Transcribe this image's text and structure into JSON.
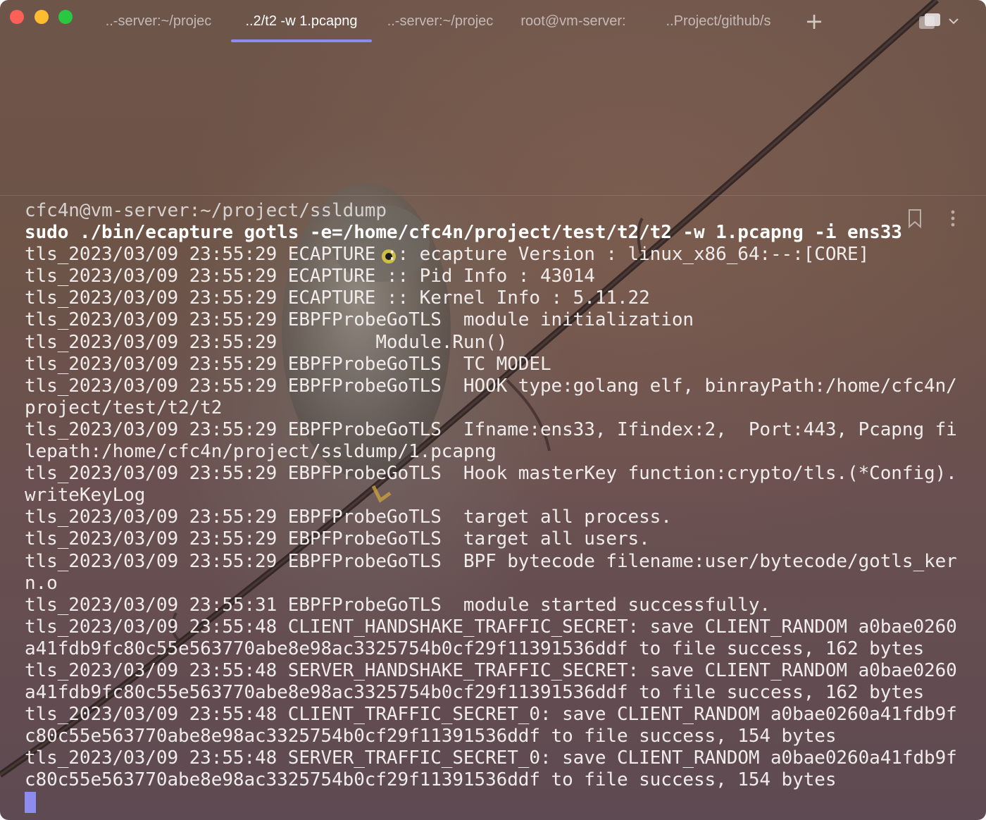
{
  "tabs": [
    {
      "label": "..-server:~/projec",
      "active": false
    },
    {
      "label": "..2/t2 -w 1.pcapng",
      "active": true
    },
    {
      "label": "..-server:~/projec",
      "active": false
    },
    {
      "label": "root@vm-server:",
      "active": false
    },
    {
      "label": "..Project/github/s",
      "active": false
    }
  ],
  "toolbar": {
    "new_tab_label": "+",
    "icons": [
      "split-view-icon",
      "chevron-down-icon",
      "bookmark-icon",
      "more-vertical-icon"
    ]
  },
  "colors": {
    "accent": "#8c8cf0",
    "text": "#f0ecec",
    "traffic_red": "#fe5f57",
    "traffic_yellow": "#febc2e",
    "traffic_green": "#28c840"
  },
  "terminal": {
    "prompt": "cfc4n@vm-server:~/project/ssldump",
    "command": "sudo ./bin/ecapture gotls -e=/home/cfc4n/project/test/t2/t2 -w 1.pcapng -i ens33",
    "lines": [
      "tls_2023/03/09 23:55:29 ECAPTURE :: ecapture Version : linux_x86_64:--:[CORE]",
      "tls_2023/03/09 23:55:29 ECAPTURE :: Pid Info : 43014",
      "tls_2023/03/09 23:55:29 ECAPTURE :: Kernel Info : 5.11.22",
      "tls_2023/03/09 23:55:29 EBPFProbeGoTLS  module initialization",
      "tls_2023/03/09 23:55:29         Module.Run()",
      "tls_2023/03/09 23:55:29 EBPFProbeGoTLS  TC MODEL",
      "tls_2023/03/09 23:55:29 EBPFProbeGoTLS  HOOK type:golang elf, binrayPath:/home/cfc4n/",
      "project/test/t2/t2",
      "tls_2023/03/09 23:55:29 EBPFProbeGoTLS  Ifname:ens33, Ifindex:2,  Port:443, Pcapng fi",
      "lepath:/home/cfc4n/project/ssldump/1.pcapng",
      "tls_2023/03/09 23:55:29 EBPFProbeGoTLS  Hook masterKey function:crypto/tls.(*Config).",
      "writeKeyLog",
      "tls_2023/03/09 23:55:29 EBPFProbeGoTLS  target all process.",
      "tls_2023/03/09 23:55:29 EBPFProbeGoTLS  target all users.",
      "tls_2023/03/09 23:55:29 EBPFProbeGoTLS  BPF bytecode filename:user/bytecode/gotls_ker",
      "n.o",
      "tls_2023/03/09 23:55:31 EBPFProbeGoTLS  module started successfully.",
      "tls_2023/03/09 23:55:48 CLIENT_HANDSHAKE_TRAFFIC_SECRET: save CLIENT_RANDOM a0bae0260",
      "a41fdb9fc80c55e563770abe8e98ac3325754b0cf29f11391536ddf to file success, 162 bytes",
      "tls_2023/03/09 23:55:48 SERVER_HANDSHAKE_TRAFFIC_SECRET: save CLIENT_RANDOM a0bae0260",
      "a41fdb9fc80c55e563770abe8e98ac3325754b0cf29f11391536ddf to file success, 162 bytes",
      "tls_2023/03/09 23:55:48 CLIENT_TRAFFIC_SECRET_0: save CLIENT_RANDOM a0bae0260a41fdb9f",
      "c80c55e563770abe8e98ac3325754b0cf29f11391536ddf to file success, 154 bytes",
      "tls_2023/03/09 23:55:48 SERVER_TRAFFIC_SECRET_0: save CLIENT_RANDOM a0bae0260a41fdb9f",
      "c80c55e563770abe8e98ac3325754b0cf29f11391536ddf to file success, 154 bytes"
    ]
  }
}
